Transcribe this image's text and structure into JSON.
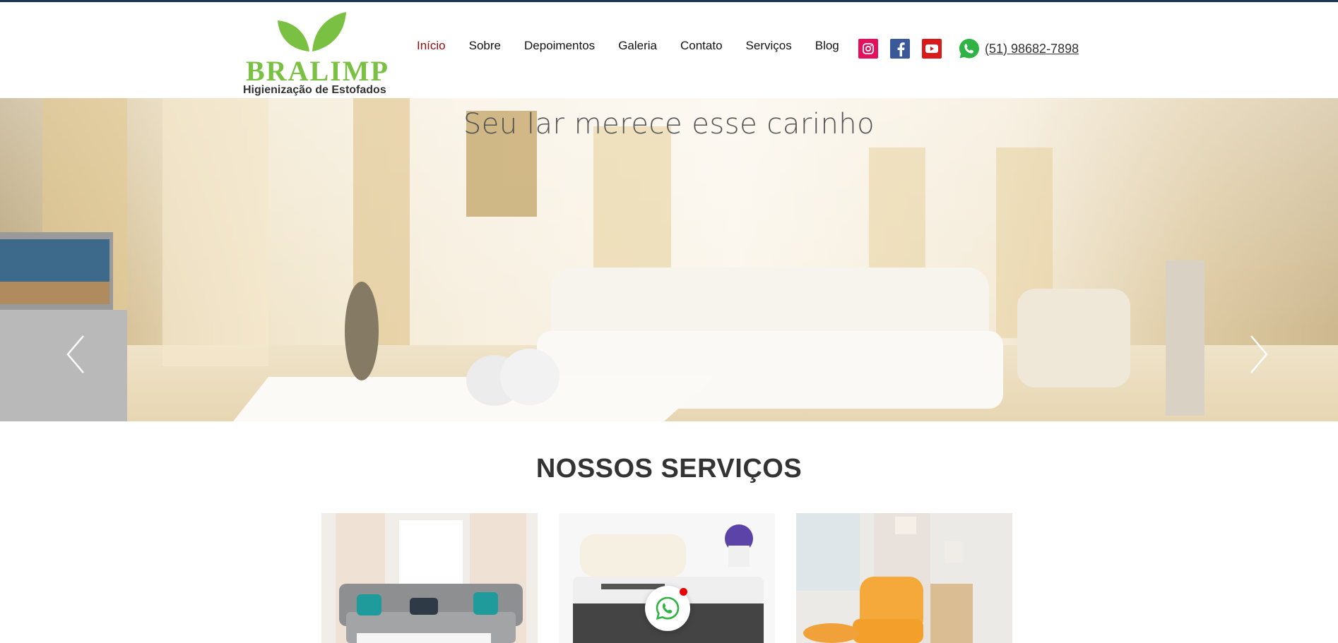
{
  "brand": {
    "name": "BRALIMP",
    "tagline": "Higienização de Estofados",
    "logo_color": "#7ac143"
  },
  "nav": {
    "items": [
      {
        "label": "Início",
        "active": true
      },
      {
        "label": "Sobre"
      },
      {
        "label": "Depoimentos"
      },
      {
        "label": "Galeria"
      },
      {
        "label": "Contato"
      },
      {
        "label": "Serviços"
      },
      {
        "label": "Blog"
      }
    ],
    "active_color": "#8b0d0d"
  },
  "social": {
    "icons": [
      "instagram-icon",
      "facebook-icon",
      "youtube-icon"
    ],
    "colors": {
      "instagram": "#e4105d",
      "facebook": "#3b5998",
      "youtube": "#d91a1a"
    }
  },
  "contact": {
    "phone": "(51) 98682-7898",
    "icon": "whatsapp-icon"
  },
  "hero": {
    "title": "Seu lar merece esse carinho",
    "prev_icon": "chevron-left-icon",
    "next_icon": "chevron-right-icon"
  },
  "services": {
    "title": "NOSSOS SERVIÇOS",
    "cards": [
      "sofa-image",
      "mattress-image",
      "armchair-image"
    ]
  },
  "floating_chat": {
    "icon": "whatsapp-icon",
    "badge_color": "#e60000"
  }
}
